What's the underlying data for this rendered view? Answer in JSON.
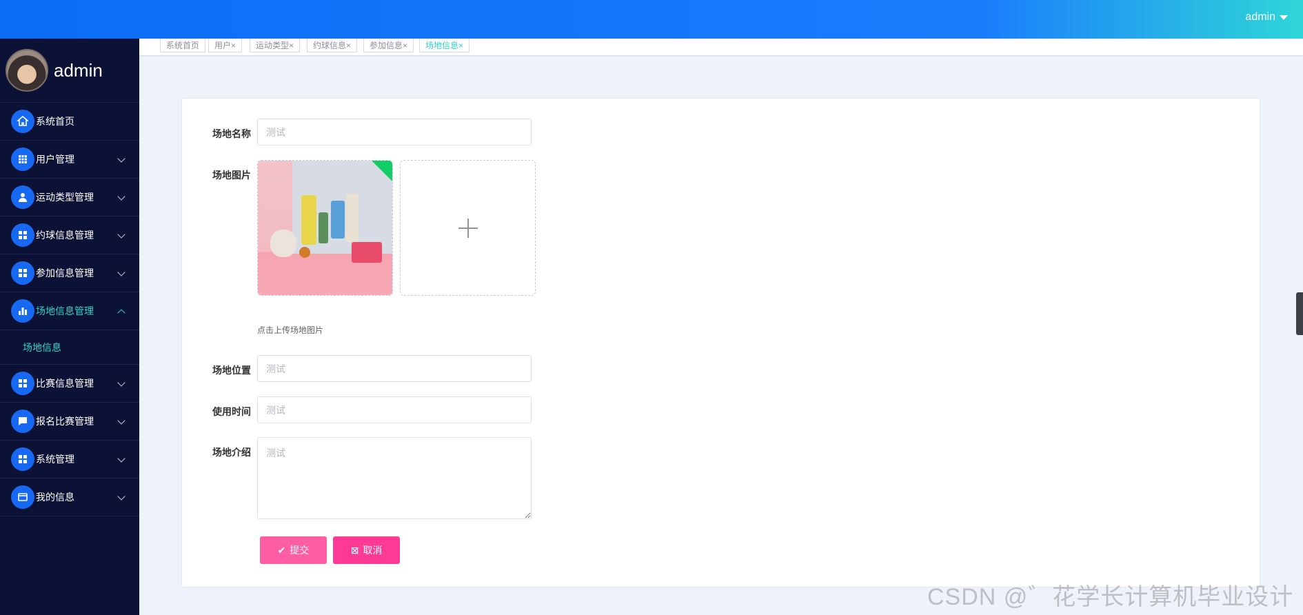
{
  "header": {
    "user": "admin"
  },
  "sidebar": {
    "profile_name": "admin",
    "items": [
      {
        "label": "系统首页",
        "icon": "home-icon"
      },
      {
        "label": "用户管理",
        "icon": "grid-icon"
      },
      {
        "label": "运动类型管理",
        "icon": "user-icon"
      },
      {
        "label": "约球信息管理",
        "icon": "apps-icon"
      },
      {
        "label": "参加信息管理",
        "icon": "apps-icon"
      },
      {
        "label": "场地信息管理",
        "icon": "bar-chart-icon"
      },
      {
        "label": "比赛信息管理",
        "icon": "apps-icon"
      },
      {
        "label": "报名比赛管理",
        "icon": "chat-icon"
      },
      {
        "label": "系统管理",
        "icon": "apps-icon"
      },
      {
        "label": "我的信息",
        "icon": "card-icon"
      }
    ],
    "submenu": {
      "label": "场地信息"
    }
  },
  "tabs": [
    {
      "label": "系统首页"
    },
    {
      "label": "用户×"
    },
    {
      "label": "运动类型×"
    },
    {
      "label": "约球信息×"
    },
    {
      "label": "参加信息×"
    },
    {
      "label": "场地信息×"
    }
  ],
  "form": {
    "name_label": "场地名称",
    "name_placeholder": "测试",
    "image_label": "场地图片",
    "upload_tip": "点击上传场地图片",
    "location_label": "场地位置",
    "location_placeholder": "测试",
    "time_label": "使用时间",
    "time_placeholder": "测试",
    "intro_label": "场地介绍",
    "intro_placeholder": "测试",
    "submit_label": "提交",
    "cancel_label": "取消"
  },
  "watermark": "CSDN @゛花学长计算机毕业设计",
  "colors": {
    "accent": "#2fd3c8",
    "sidebar_bg": "#0c1235",
    "submit": "#ff5ea5",
    "cancel": "#ff3a94"
  }
}
